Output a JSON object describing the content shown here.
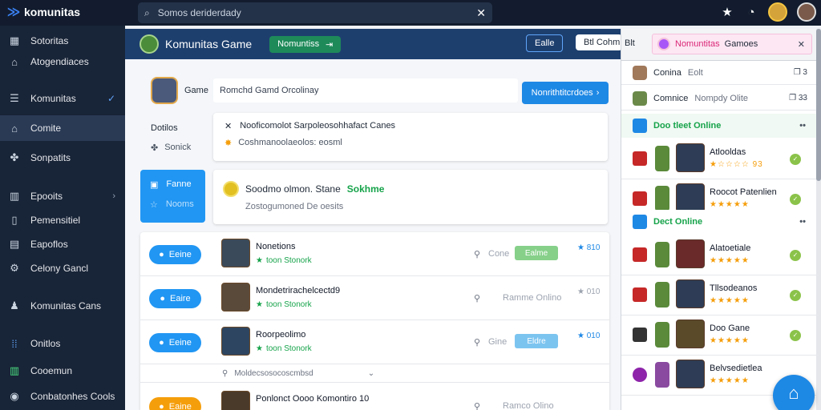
{
  "app": {
    "name": "komunitas"
  },
  "search": {
    "value": "Somos deriderdady"
  },
  "sidebar": {
    "items": [
      {
        "label": "Sotoritas",
        "icon": "grid-icon"
      },
      {
        "label": "Atogendiaces",
        "icon": "home-icon"
      },
      {
        "label": "Komunitas",
        "icon": "list-icon"
      },
      {
        "label": "Comite",
        "icon": "home-icon"
      },
      {
        "label": "Sonpatits",
        "icon": "puzzle-icon"
      },
      {
        "label": "Epooits",
        "icon": "chart-icon"
      },
      {
        "label": "Pemensitiel",
        "icon": "columns-icon"
      },
      {
        "label": "Eapoflos",
        "icon": "table-icon"
      },
      {
        "label": "Celony Gancl",
        "icon": "settings-icon"
      },
      {
        "label": "Komunitas Cans",
        "icon": "users-icon"
      },
      {
        "label": "Onitlos",
        "icon": "dots-grid-icon"
      },
      {
        "label": "Cooemun",
        "icon": "chart-icon"
      },
      {
        "label": "Conbatonhes Cools",
        "icon": "avatar-icon"
      }
    ]
  },
  "header": {
    "title": "Komunitas Game",
    "badge": "Nomuntiss",
    "badge_arrow": "⇥",
    "btn1": "Ealle",
    "btn2": "Btl Cohmicar"
  },
  "main": {
    "game_label": "Game",
    "game_input": "Romchd Gamd Orcolinay",
    "cta": "Nonrithtitcrdoes",
    "dotitos": "Dotilos",
    "sonick": "Sonick",
    "notif_title": "Nooficomolot Sarpoleosohhafact Canes",
    "notif_sub": "Coshmanoolaeolos: eosml",
    "blue_box_1": "Fanne",
    "blue_box_2": "Nooms",
    "banner_title": "Soodmo olmon. Stane",
    "banner_highlight": "Sokhme",
    "banner_sub": "Zostogumoned De oesits",
    "divider_text": "Moldecsosocoscmbsd"
  },
  "list": [
    {
      "btn": "Eeine",
      "name": "Nonetions",
      "meta": "toon Stonork",
      "status": "Cone",
      "tag": "Ealme",
      "score": "★ 810"
    },
    {
      "btn": "Eaire",
      "name": "Mondetrirachelcectd9",
      "meta": "toon Stonork",
      "status": "Ramme Onlino",
      "tag": "",
      "score": "★ 010"
    },
    {
      "btn": "Eeine",
      "name": "Roorpeolimo",
      "meta": "toon Stonork",
      "status": "Gine",
      "tag": "Eldre",
      "score": "★ 010"
    },
    {
      "btn": "Eaine",
      "name": "Ponlonct Oooo Komontiro 10",
      "meta": "",
      "status": "Ramco Olino",
      "tag": "",
      "score": ""
    }
  ],
  "right_panel": {
    "tab1": "Blt",
    "tab2_pink": "Nomuntitas",
    "tab2_label": "Gamoes",
    "row1": {
      "name": "Conina",
      "sub": "Eolt",
      "right": "❐ 3"
    },
    "row2": {
      "name": "Comnice",
      "sub": "Nompdy Olite",
      "right": "❐ 33"
    },
    "section1": "Doo tleet Online",
    "section2": "Dect Online",
    "players": [
      {
        "name": "Atlooldas",
        "stars": "★☆☆☆☆ 93"
      },
      {
        "name": "Roocot Patenlien",
        "stars": "★★★★★"
      },
      {
        "name": "Alatoetiale",
        "stars": "★★★★★"
      },
      {
        "name": "Tllsodeanos",
        "stars": "★★★★★"
      },
      {
        "name": "Doo Gane",
        "stars": "★★★★★"
      },
      {
        "name": "Belvsedietlea",
        "stars": "★★★★★"
      }
    ]
  },
  "colors": {
    "primary": "#1e88e5",
    "sidebar": "#182437",
    "header": "#1d3f6e",
    "success": "#16a34a"
  }
}
